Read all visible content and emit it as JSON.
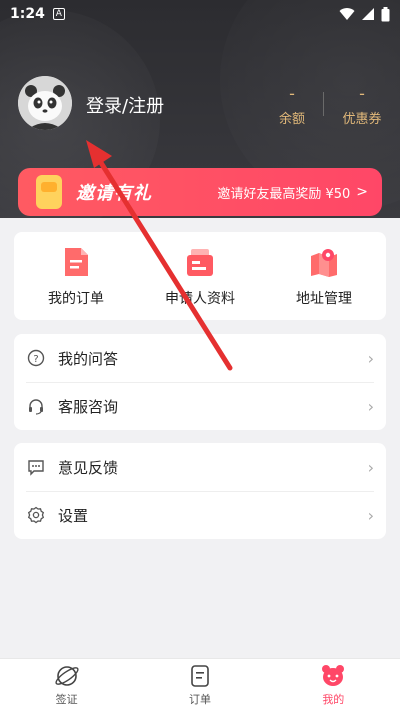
{
  "status": {
    "time": "1:24",
    "notif": "A"
  },
  "header": {
    "login": "登录/注册",
    "balance": {
      "value": "-",
      "label": "余额"
    },
    "coupon": {
      "value": "-",
      "label": "优惠券"
    }
  },
  "invite": {
    "title": "邀请有礼",
    "subtitle": "邀请好友最高奖励 ¥50",
    "arrow": ">"
  },
  "quick": {
    "orders": "我的订单",
    "applicant": "申请人资料",
    "address": "地址管理"
  },
  "menu": {
    "qa": "我的问答",
    "service": "客服咨询",
    "feedback": "意见反馈",
    "settings": "设置"
  },
  "tabs": {
    "visa": "签证",
    "orders": "订单",
    "mine": "我的"
  },
  "colors": {
    "accent": "#ff4767",
    "gold": "#e2b97a",
    "header_dark": "#2c2c30",
    "annotation": "#e53030"
  },
  "icons": {
    "avatar": "panda-avatar",
    "orders": "document-icon",
    "applicant": "id-card-icon",
    "address": "map-pin-icon",
    "qa": "question-icon",
    "service": "headset-icon",
    "feedback": "chat-icon",
    "settings": "gear-icon",
    "visa": "planet-icon",
    "tab_orders": "list-icon",
    "mine": "bear-icon"
  }
}
